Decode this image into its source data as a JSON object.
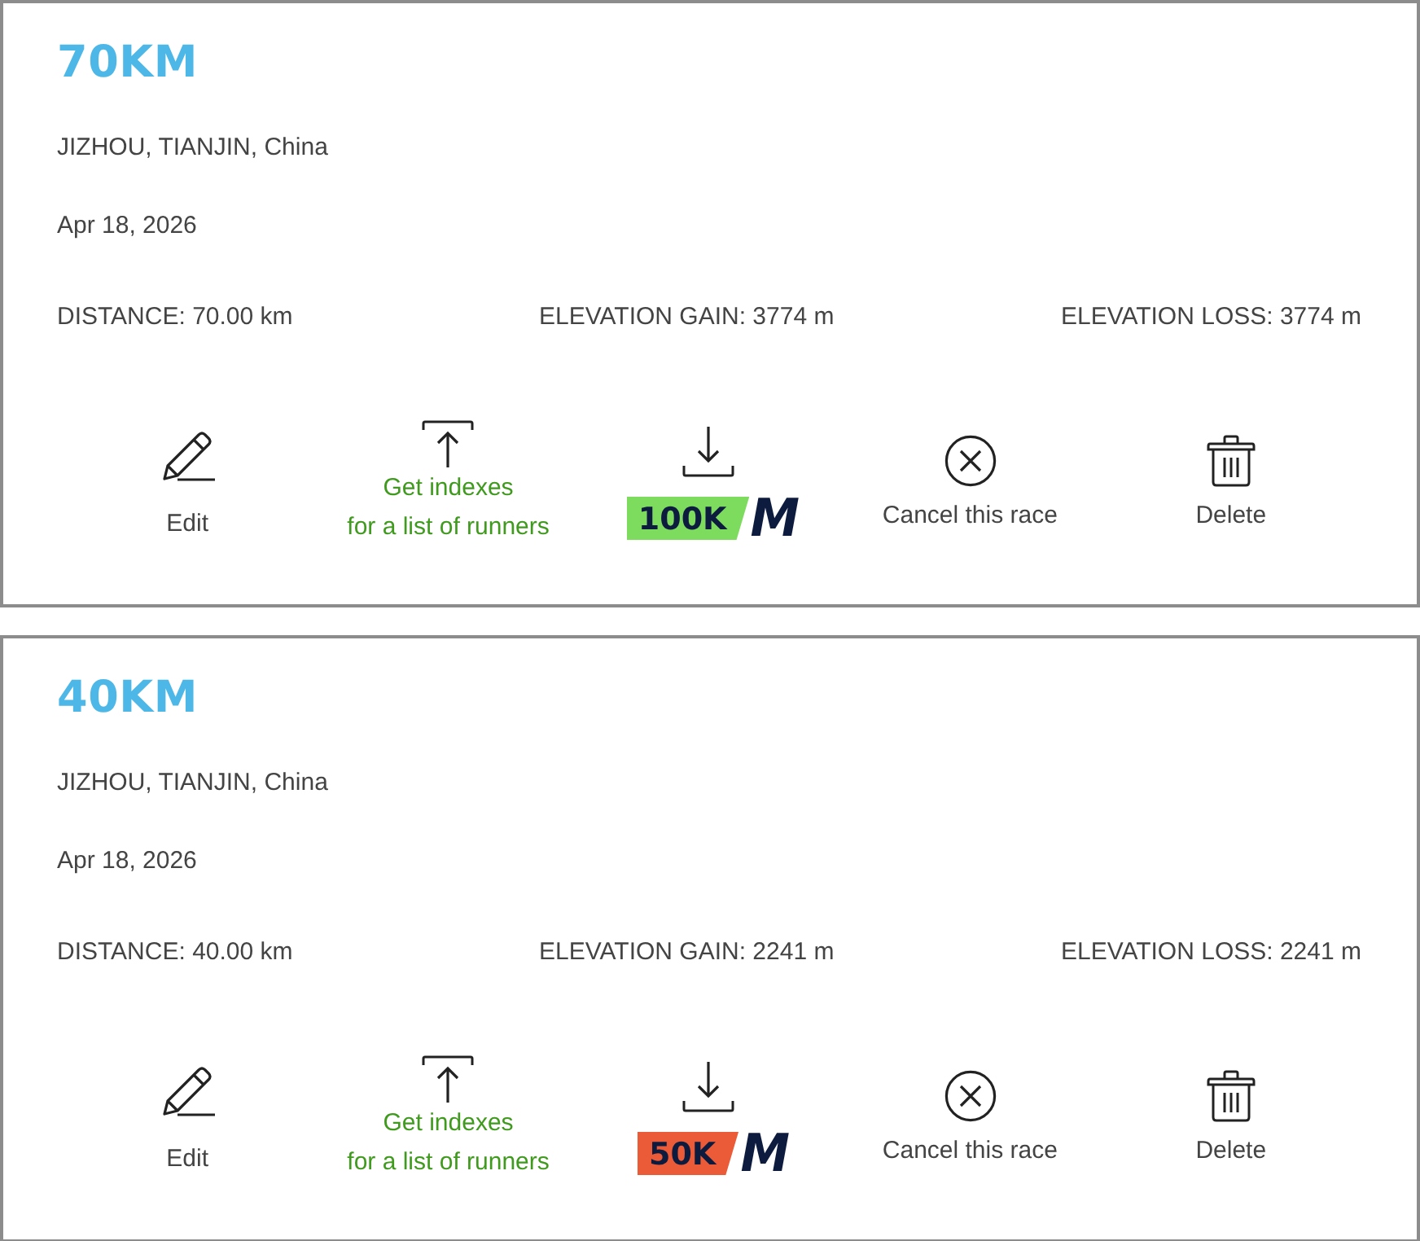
{
  "races": [
    {
      "title": "70KM",
      "location": "JIZHOU, TIANJIN, China",
      "date": "Apr 18, 2026",
      "stats": [
        "DISTANCE: 70.00 km",
        "ELEVATION GAIN: 3774 m",
        "ELEVATION LOSS: 3774 m"
      ],
      "actions": [
        {
          "kind": "edit",
          "label": "Edit"
        },
        {
          "kind": "indexes",
          "label": "Get indexes\nfor a list of runners"
        },
        {
          "kind": "download",
          "badge": "100K",
          "color": "#7ddb5e",
          "logo": "M"
        },
        {
          "kind": "cancel",
          "label": "Cancel this race"
        },
        {
          "kind": "delete",
          "label": "Delete"
        }
      ]
    },
    {
      "title": "40KM",
      "location": "JIZHOU, TIANJIN, China",
      "date": "Apr 18, 2026",
      "stats": [
        "DISTANCE: 40.00 km",
        "ELEVATION GAIN: 2241 m",
        "ELEVATION LOSS: 2241 m"
      ],
      "actions": [
        {
          "kind": "edit",
          "label": "Edit"
        },
        {
          "kind": "indexes",
          "label": "Get indexes\nfor a list of runners"
        },
        {
          "kind": "download",
          "badge": "50K",
          "color": "#ec5b37",
          "logo": "M"
        },
        {
          "kind": "cancel",
          "label": "Cancel this race"
        },
        {
          "kind": "delete",
          "label": "Delete"
        }
      ]
    }
  ]
}
